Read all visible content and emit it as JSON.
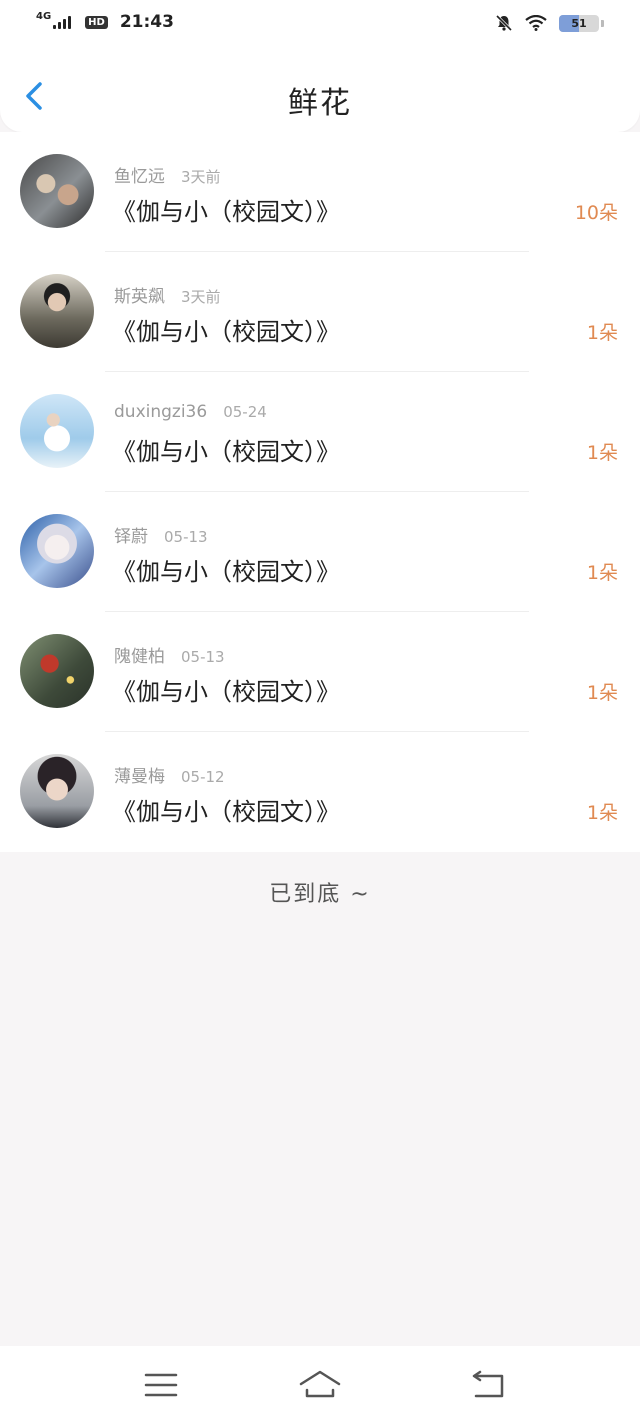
{
  "status_bar": {
    "network": "4G",
    "hd": "HD",
    "time": "21:43",
    "battery": "51",
    "battery_level": 0.51
  },
  "header": {
    "title": "鲜花"
  },
  "colors": {
    "accent": "#2b8fe3",
    "count": "#e08a52"
  },
  "flowers": [
    {
      "user": "鱼忆远",
      "time": "3天前",
      "book": "《伽与小（校园文）》",
      "count": "10朵"
    },
    {
      "user": "斯英飙",
      "time": "3天前",
      "book": "《伽与小（校园文）》",
      "count": "1朵"
    },
    {
      "user": "duxingzi36",
      "time": "05-24",
      "book": "《伽与小（校园文）》",
      "count": "1朵"
    },
    {
      "user": "铎蔚",
      "time": "05-13",
      "book": "《伽与小（校园文）》",
      "count": "1朵"
    },
    {
      "user": "隗健柏",
      "time": "05-13",
      "book": "《伽与小（校园文）》",
      "count": "1朵"
    },
    {
      "user": "薄曼梅",
      "time": "05-12",
      "book": "《伽与小（校园文）》",
      "count": "1朵"
    }
  ],
  "footer": {
    "end_text": "已到底 ~"
  },
  "nav": {
    "icons": [
      "menu-icon",
      "home-icon",
      "back-icon"
    ]
  }
}
